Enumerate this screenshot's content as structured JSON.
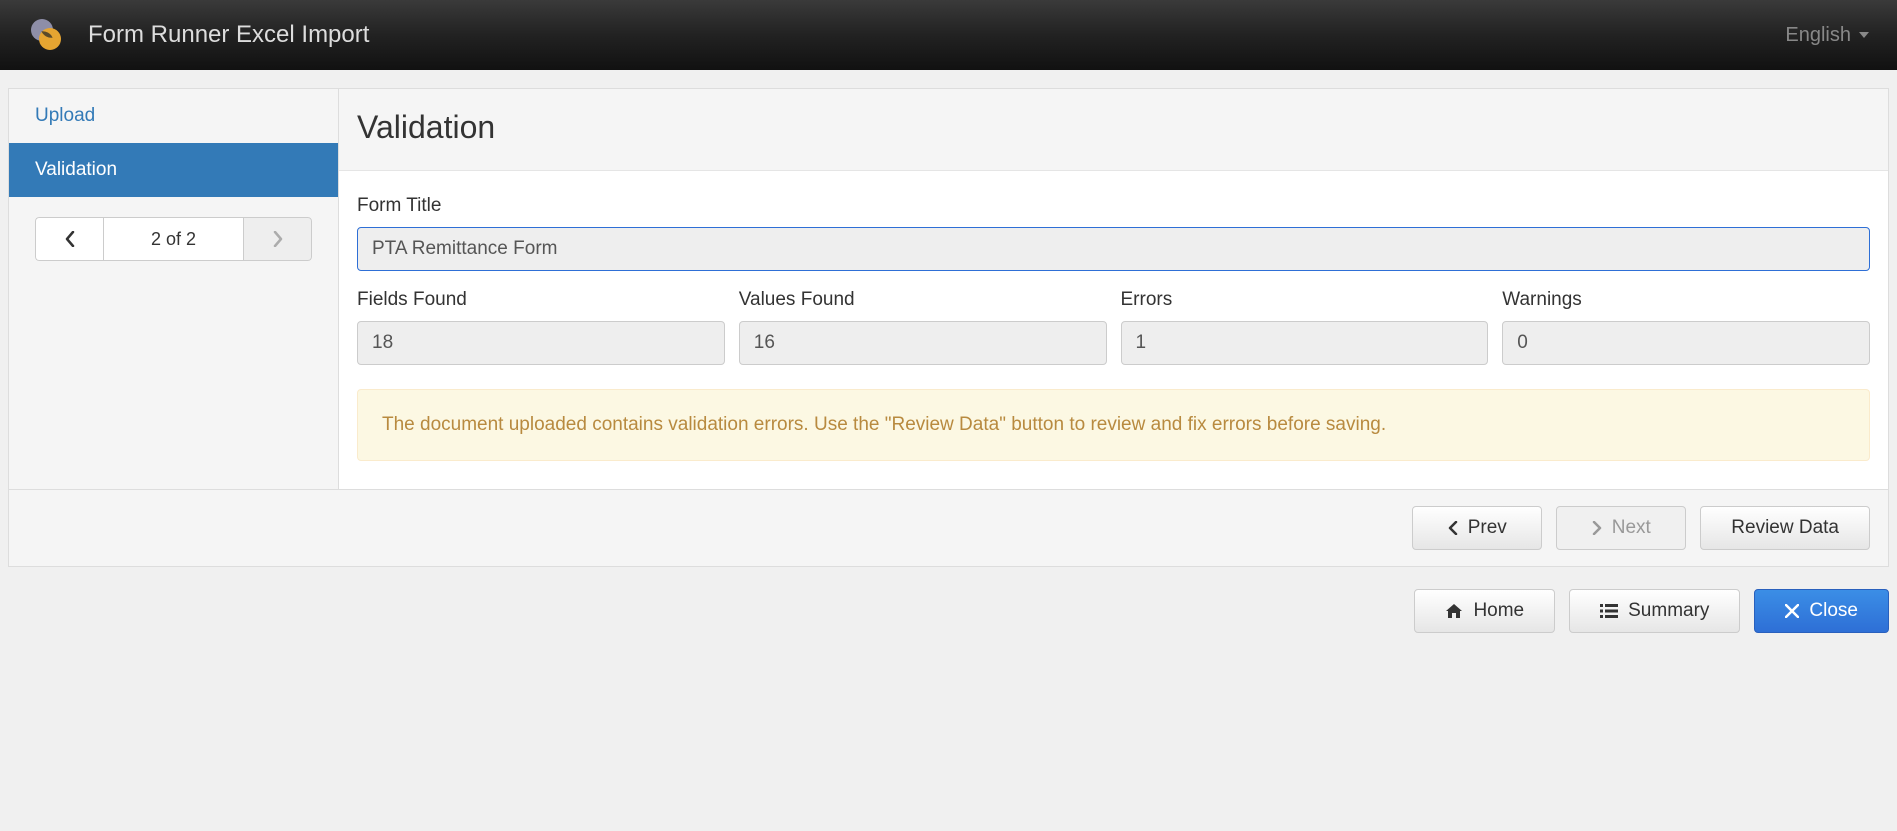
{
  "header": {
    "app_title": "Form Runner Excel Import",
    "language": "English"
  },
  "sidebar": {
    "items": [
      {
        "label": "Upload"
      },
      {
        "label": "Validation"
      }
    ],
    "pager": "2 of 2"
  },
  "main": {
    "title": "Validation",
    "form_title_label": "Form Title",
    "form_title_value": "PTA Remittance Form",
    "stats": {
      "fields_found_label": "Fields Found",
      "fields_found_value": "18",
      "values_found_label": "Values Found",
      "values_found_value": "16",
      "errors_label": "Errors",
      "errors_value": "1",
      "warnings_label": "Warnings",
      "warnings_value": "0"
    },
    "alert": "The document uploaded contains validation errors. Use the \"Review Data\" button to review and fix errors before saving."
  },
  "wizard_nav": {
    "prev": "Prev",
    "next": "Next",
    "review": "Review Data"
  },
  "footer": {
    "home": "Home",
    "summary": "Summary",
    "close": "Close"
  }
}
